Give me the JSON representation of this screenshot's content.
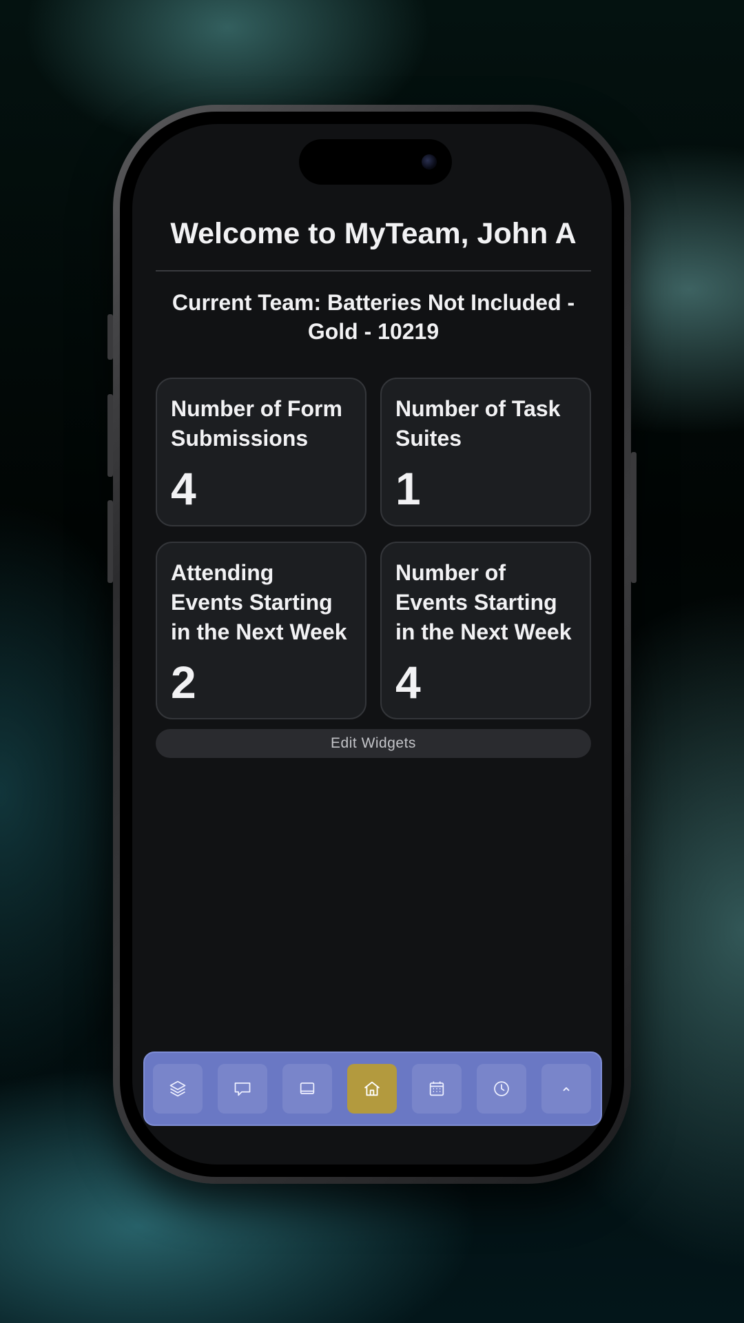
{
  "header": {
    "welcome": "Welcome to MyTeam, John A",
    "current_team": "Current Team: Batteries Not Included - Gold - 10219"
  },
  "widgets": [
    {
      "title": "Number of Form Submissions",
      "value": "4"
    },
    {
      "title": "Number of Task Suites",
      "value": "1"
    },
    {
      "title": "Attending Events Starting in the Next Week",
      "value": "2"
    },
    {
      "title": "Number of Events Starting in the Next Week",
      "value": "4"
    }
  ],
  "edit_widgets_label": "Edit Widgets",
  "nav": {
    "items": [
      {
        "icon": "layers-icon",
        "active": false
      },
      {
        "icon": "chat-icon",
        "active": false
      },
      {
        "icon": "tablet-icon",
        "active": false
      },
      {
        "icon": "home-icon",
        "active": true
      },
      {
        "icon": "calendar-icon",
        "active": false
      },
      {
        "icon": "clock-icon",
        "active": false
      },
      {
        "icon": "chevron-up-icon",
        "active": false
      }
    ],
    "active_color": "#b39a3e",
    "bar_color": "#6a78c4"
  }
}
